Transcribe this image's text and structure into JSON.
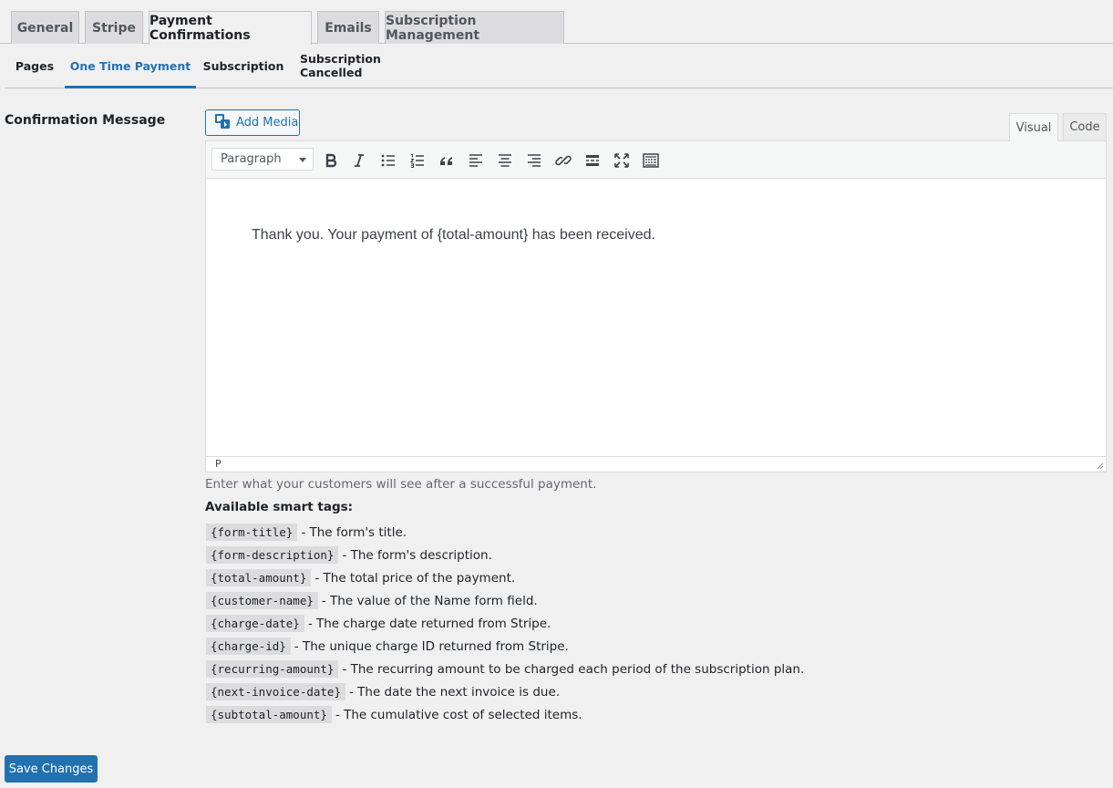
{
  "nav_tabs": [
    {
      "label": "General"
    },
    {
      "label": "Stripe"
    },
    {
      "label": "Payment Confirmations"
    },
    {
      "label": "Emails"
    },
    {
      "label": "Subscription Management"
    }
  ],
  "active_nav_tab": "Payment Confirmations",
  "subtabs": [
    {
      "label": "Pages"
    },
    {
      "label": "One Time Payment"
    },
    {
      "label": "Subscription"
    },
    {
      "label": "Subscription Cancelled"
    }
  ],
  "active_subtab": "One Time Payment",
  "field": {
    "label": "Confirmation Message"
  },
  "editor": {
    "add_media_label": "Add Media",
    "mode_tabs": {
      "visual": "Visual",
      "code": "Code"
    },
    "active_mode": "Visual",
    "format_select_value": "Paragraph",
    "toolbar_icons": [
      "bold-icon",
      "italic-icon",
      "bullet-list-icon",
      "numbered-list-icon",
      "blockquote-icon",
      "align-left-icon",
      "align-center-icon",
      "align-right-icon",
      "link-icon",
      "read-more-icon",
      "fullscreen-icon",
      "toolbar-toggle-icon"
    ],
    "content": "Thank you. Your payment of {total-amount} has been received.",
    "path": "P"
  },
  "description": "Enter what your customers will see after a successful payment.",
  "smart_tags": {
    "heading": "Available smart tags:",
    "items": [
      {
        "tag": "{form-title}",
        "desc": "- The form's title."
      },
      {
        "tag": "{form-description}",
        "desc": "- The form's description."
      },
      {
        "tag": "{total-amount}",
        "desc": "- The total price of the payment."
      },
      {
        "tag": "{customer-name}",
        "desc": "- The value of the Name form field."
      },
      {
        "tag": "{charge-date}",
        "desc": "- The charge date returned from Stripe."
      },
      {
        "tag": "{charge-id}",
        "desc": "- The unique charge ID returned from Stripe."
      },
      {
        "tag": "{recurring-amount}",
        "desc": "- The recurring amount to be charged each period of the subscription plan."
      },
      {
        "tag": "{next-invoice-date}",
        "desc": "- The date the next invoice is due."
      },
      {
        "tag": "{subtotal-amount}",
        "desc": "- The cumulative cost of selected items."
      }
    ]
  },
  "save_button_label": "Save Changes",
  "colors": {
    "accent": "#2271b1",
    "background": "#f0f0f1",
    "tab_inactive": "#dcdcde"
  }
}
